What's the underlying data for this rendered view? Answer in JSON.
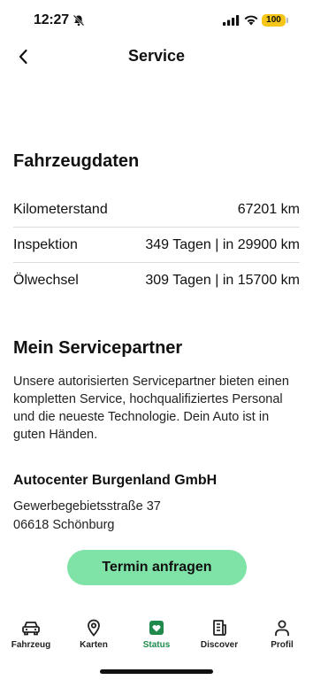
{
  "status_bar": {
    "time": "12:27",
    "battery": "100"
  },
  "header": {
    "title": "Service"
  },
  "vehicle_data": {
    "title": "Fahrzeugdaten",
    "rows": [
      {
        "label": "Kilometerstand",
        "value": "67201 km"
      },
      {
        "label": "Inspektion",
        "value": "349 Tagen | in 29900 km"
      },
      {
        "label": "Ölwechsel",
        "value": "309 Tagen | in 15700 km"
      }
    ]
  },
  "service_partner": {
    "title": "Mein Servicepartner",
    "description": "Unsere autorisierten Servicepartner bieten einen kompletten Service, hochqualifiziertes Personal und die neueste Technologie. Dein Auto ist in guten Händen.",
    "name": "Autocenter Burgenland GmbH",
    "street": "Gewerbegebietsstraße 37",
    "city": "06618 Schönburg",
    "button_label": "Termin anfragen"
  },
  "tab_bar": {
    "items": [
      {
        "label": "Fahrzeug",
        "icon": "car-icon"
      },
      {
        "label": "Karten",
        "icon": "map-pin-icon"
      },
      {
        "label": "Status",
        "icon": "heart-badge-icon",
        "active": true
      },
      {
        "label": "Discover",
        "icon": "news-icon"
      },
      {
        "label": "Profil",
        "icon": "person-icon"
      }
    ]
  },
  "colors": {
    "accent": "#7fe3a7",
    "active_tab": "#1f8a4c",
    "battery": "#f5c518"
  }
}
